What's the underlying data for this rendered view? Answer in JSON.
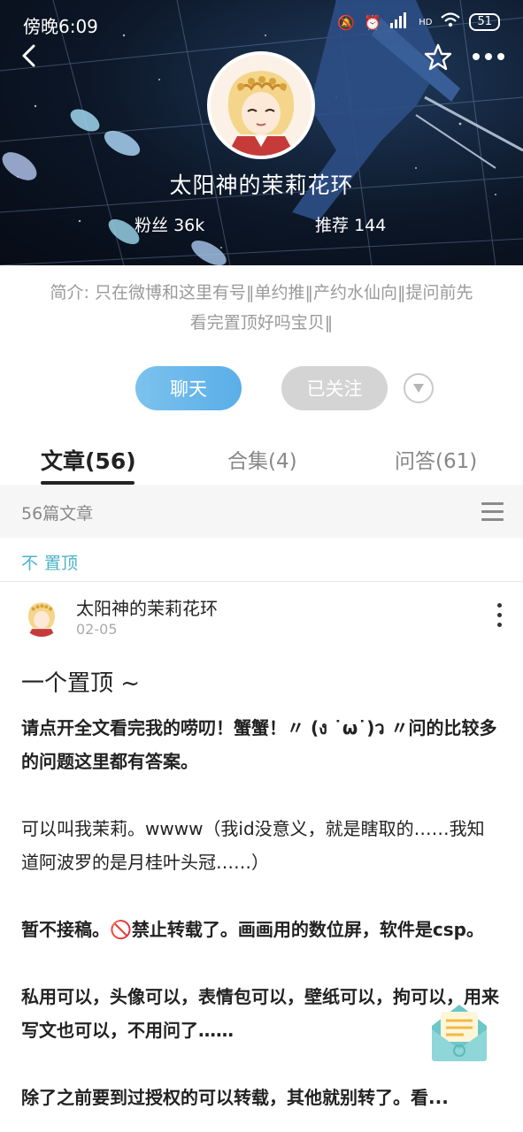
{
  "status_bar": {
    "time": "傍晚6:09",
    "network": "HD",
    "battery": "51"
  },
  "profile": {
    "name": "太阳神的茉莉花环",
    "fans_label": "粉丝",
    "fans_value": "36k",
    "recommend_label": "推荐",
    "recommend_value": "144",
    "bio_line1": "简介: 只在微博和这里有号‖单约推‖产约水仙向‖提问前先",
    "bio_line2": "看完置顶好吗宝贝‖"
  },
  "actions": {
    "chat_label": "聊天",
    "follow_label": "已关注"
  },
  "tabs": [
    {
      "label": "文章(56)",
      "active": true
    },
    {
      "label": "合集(4)",
      "active": false
    },
    {
      "label": "问答(61)",
      "active": false
    }
  ],
  "list": {
    "count_label": "56篇文章",
    "pinned_icon": "不",
    "pinned_label": "置顶"
  },
  "post": {
    "author": "太阳神的茉莉花环",
    "date": "02-05",
    "title": "一个置顶 ~",
    "para1": "请点开全文看完我的唠叨！蟹蟹！〃 (ง ˙ω˙)ว 〃问的比较多的问题这里都有答案。",
    "para2": "可以叫我茉莉。wwww（我id没意义，就是瞎取的……我知道阿波罗的是月桂叶头冠……）",
    "para3": "暂不接稿。🚫禁止转载了。画画用的数位屏，软件是csp。",
    "para4": "私用可以，头像可以，表情包可以，壁纸可以，拘可以，用来写文也可以，不用问了……",
    "para5": "除了之前要到过授权的可以转载，其他就别转了。看..."
  },
  "icons": {
    "back": "chevron-left-icon",
    "favorite": "star-outline-icon",
    "more": "more-horizontal-icon",
    "dropdown": "triangle-down-icon",
    "list_menu": "hamburger-icon",
    "pinned": "pin-icon",
    "post_more": "more-vertical-icon",
    "floating": "mail-envelope-icon"
  },
  "colors": {
    "chat_button": "#5aaee8",
    "follow_button": "#d4d4d4",
    "pinned_accent": "#4bb3c8"
  }
}
